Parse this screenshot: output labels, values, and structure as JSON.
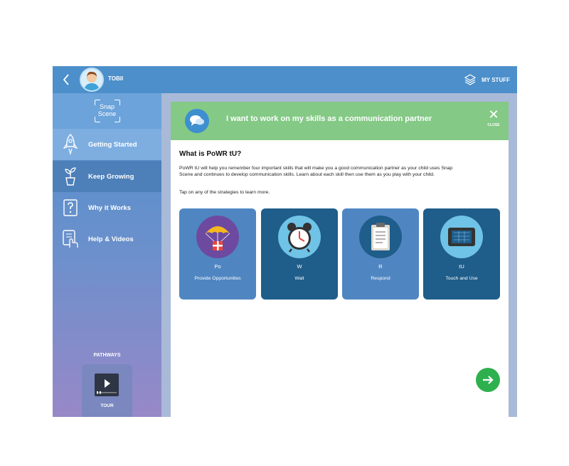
{
  "header": {
    "username": "TOBII",
    "my_stuff_label": "MY STUFF"
  },
  "sidebar": {
    "logo_line1": "Snap",
    "logo_line2": "Scene",
    "items": [
      {
        "label": "Getting Started",
        "icon": "rocket-icon"
      },
      {
        "label": "Keep Growing",
        "icon": "plant-icon"
      },
      {
        "label": "Why it Works",
        "icon": "question-icon"
      },
      {
        "label": "Help & Videos",
        "icon": "tablet-hand-icon"
      }
    ],
    "pathways_label": "PATHWAYS",
    "tour_label": "TOUR"
  },
  "banner": {
    "title": "I want to work on my skills as a communication partner",
    "close_label": "CLOSE"
  },
  "main": {
    "heading": "What is PoWR tU?",
    "description": "PoWR tU will help you remember four important skills that will make you a good communication partner as your child uses Snap Scene and continues to develop communication skills. Learn about each skill then use them as you play with your child.",
    "instruction": "Tap on any of the strategies to learn more."
  },
  "strategies": [
    {
      "abbr": "Po",
      "name": "Provide Opportunities",
      "icon": "parachute-gift-icon"
    },
    {
      "abbr": "W",
      "name": "Wait",
      "icon": "alarm-clock-icon"
    },
    {
      "abbr": "R",
      "name": "Respond",
      "icon": "clipboard-icon"
    },
    {
      "abbr": "tU",
      "name": "Touch and Use",
      "icon": "tablet-icon"
    }
  ],
  "colors": {
    "topbar": "#4c8fca",
    "banner": "#84c986",
    "card_light": "#4f86c2",
    "card_dark": "#1f5d8a",
    "next_button": "#2fb04f"
  }
}
